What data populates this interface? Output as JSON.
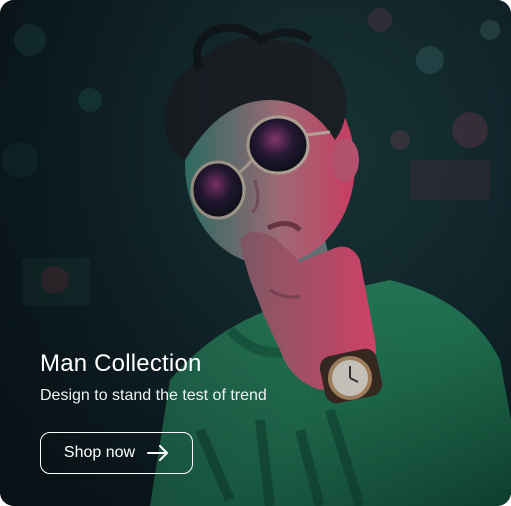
{
  "banner": {
    "title": "Man Collection",
    "subtitle": "Design to stand the test of trend",
    "button_label": "Shop now",
    "button_icon": "arrow-right-icon"
  },
  "colors": {
    "text": "#ffffff",
    "background": "#0f1c22",
    "accent_green": "#2e8a62",
    "accent_pink": "#e0336b"
  }
}
